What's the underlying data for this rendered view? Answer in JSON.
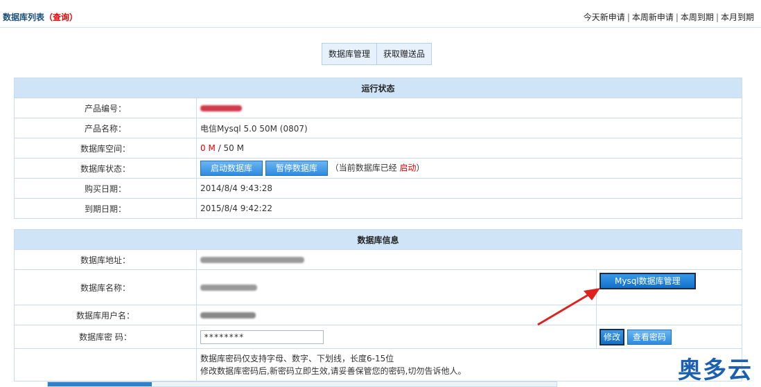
{
  "header": {
    "breadcrumb": "数据库列表",
    "breadcrumb_query": "（查询）",
    "quick_links": [
      "今天新申请",
      "本周新申请",
      "本周到期",
      "本月到期"
    ]
  },
  "tabs": [
    "数据库管理",
    "获取赠送品"
  ],
  "status_section": {
    "title": "运行状态",
    "product_id": {
      "label": "产品编号："
    },
    "product_name": {
      "label": "产品名称：",
      "value": "电信Mysql 5.0 50M (0807)"
    },
    "db_space": {
      "label": "数据库空间：",
      "used": "0 M",
      "total": " / 50 M"
    },
    "db_status": {
      "label": "数据库状态：",
      "start_button": "启动数据库",
      "pause_button": "暂停数据库",
      "note_prefix": "（当前数据库已经",
      "note_state": "启动",
      "note_suffix": "）"
    },
    "purchase_date": {
      "label": "购买日期：",
      "value": "2014/8/4 9:43:28"
    },
    "expire_date": {
      "label": "到期日期：",
      "value": "2015/8/4 9:42:22"
    }
  },
  "info_section": {
    "title": "数据库信息",
    "address": {
      "label": "数据库地址："
    },
    "name": {
      "label": "数据库名称：",
      "manage_button": "Mysql数据库管理"
    },
    "user": {
      "label": "数据库用户名："
    },
    "password": {
      "label": "数据库密  码：",
      "value": "********",
      "modify_button": "修改",
      "view_button": "查看密码"
    },
    "hint_1": "数据库密码仅支持字母、数字、下划线，长度6-15位",
    "hint_2": "修改数据库密码后,新密码立即生效,请妥善保管您的密码,切勿告诉他人。"
  },
  "watermark": "奥多云",
  "colors": {
    "accent_red": "#e60000",
    "header_blue": "#cfe4f6",
    "button_blue": "#2f8be0",
    "arrow_red": "#e0201c"
  }
}
